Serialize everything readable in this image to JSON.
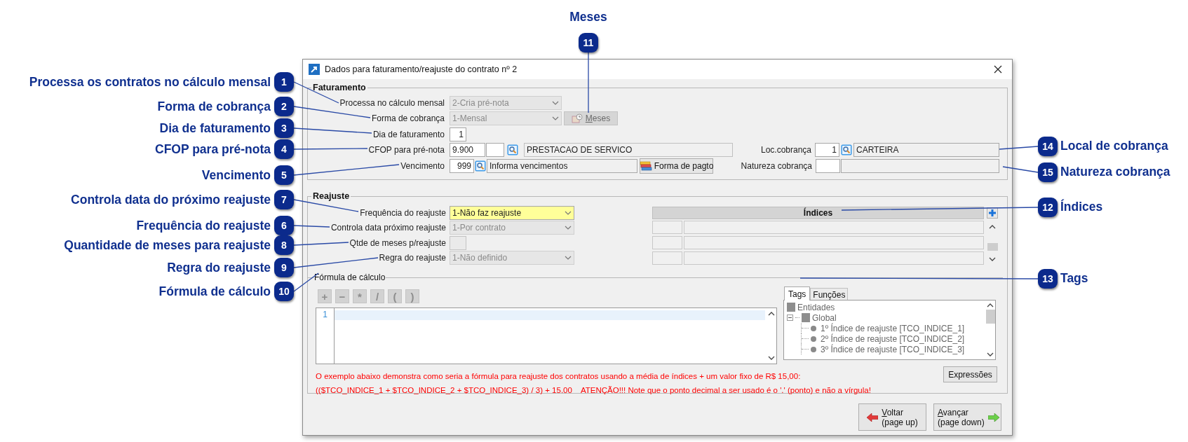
{
  "window": {
    "title": "Dados para faturamento/reajuste do contrato nº 2"
  },
  "faturamento": {
    "title": "Faturamento",
    "processa": {
      "label": "Processa no cálculo mensal",
      "value": "2-Cria pré-nota",
      "disabled": true
    },
    "forma_cobranca": {
      "label": "Forma de cobrança",
      "value": "1-Mensal",
      "disabled": true
    },
    "meses_button": {
      "label": "Meses",
      "disabled": true
    },
    "dia": {
      "label": "Dia de faturamento",
      "value": "1"
    },
    "cfop": {
      "label": "CFOP para pré-nota",
      "code": "9.900",
      "description": "PRESTACAO DE SERVICO"
    },
    "vencimento": {
      "label": "Vencimento",
      "code": "999",
      "description": "Informa vencimentos"
    },
    "forma_pagto_button": "Forma de pagto",
    "loc_cobranca": {
      "label": "Loc.cobrança",
      "code": "1",
      "description": "CARTEIRA"
    },
    "natureza": {
      "label": "Natureza cobrança"
    }
  },
  "reajuste": {
    "title": "Reajuste",
    "frequencia": {
      "label": "Frequência do reajuste",
      "value": "1-Não faz reajuste",
      "disabled": false,
      "focused": true
    },
    "controla": {
      "label": "Controla data próximo reajuste",
      "value": "1-Por contrato",
      "disabled": true
    },
    "qtde": {
      "label": "Qtde de meses p/reajuste"
    },
    "regra": {
      "label": "Regra do reajuste",
      "value": "1-Não definido",
      "disabled": true
    },
    "indices_header": "Índices"
  },
  "formula": {
    "title": "Fórmula de cálculo",
    "toolbar": [
      "+",
      "−",
      "*",
      "/",
      "(",
      ")"
    ],
    "line_numbers": [
      "1"
    ],
    "tabs": [
      {
        "label": "Tags",
        "selected": true
      },
      {
        "label": "Funções",
        "selected": false
      }
    ],
    "tree": [
      {
        "label": "Entidades",
        "children": [
          {
            "label": "Global",
            "expanded": true,
            "children": [
              {
                "label": "1º Índice de reajuste [TCO_INDICE_1]"
              },
              {
                "label": "2º Índice de reajuste [TCO_INDICE_2]"
              },
              {
                "label": "3º Índice de reajuste [TCO_INDICE_3]"
              }
            ]
          }
        ]
      }
    ],
    "example_note": "O exemplo abaixo demonstra como seria a fórmula para reajuste dos contratos usando a média de índices + um valor fixo de R$ 15,00:",
    "example_formula": "(($TCO_INDICE_1 + $TCO_INDICE_2 + $TCO_INDICE_3) / 3) + 15.00",
    "warning": "ATENÇÃO!!! Note que o ponto decimal a ser usado é o '.' (ponto) e não a vírgula!",
    "expressoes_button": "Expressões"
  },
  "nav_buttons": [
    {
      "label": "Voltar",
      "hint": "(page up)",
      "kind": "back"
    },
    {
      "label": "Avançar",
      "hint": "(page down)",
      "kind": "next"
    }
  ],
  "callouts": [
    {
      "number": "11",
      "label": "Meses"
    },
    {
      "number": "1",
      "label": "Processa os contratos no cálculo mensal"
    },
    {
      "number": "2",
      "label": "Forma de cobrança"
    },
    {
      "number": "3",
      "label": "Dia de faturamento"
    },
    {
      "number": "4",
      "label": "CFOP para pré-nota"
    },
    {
      "number": "5",
      "label": "Vencimento"
    },
    {
      "number": "14",
      "label": "Local de cobrança"
    },
    {
      "number": "15",
      "label": "Natureza cobrança"
    },
    {
      "number": "7",
      "label": "Controla data do próximo reajuste"
    },
    {
      "number": "6",
      "label": "Frequência do reajuste"
    },
    {
      "number": "12",
      "label": "Índices"
    },
    {
      "number": "8",
      "label": "Quantidade de meses para reajuste"
    },
    {
      "number": "9",
      "label": "Regra do reajuste"
    },
    {
      "number": "10",
      "label": "Fórmula de cálculo"
    },
    {
      "number": "13",
      "label": "Tags"
    }
  ]
}
